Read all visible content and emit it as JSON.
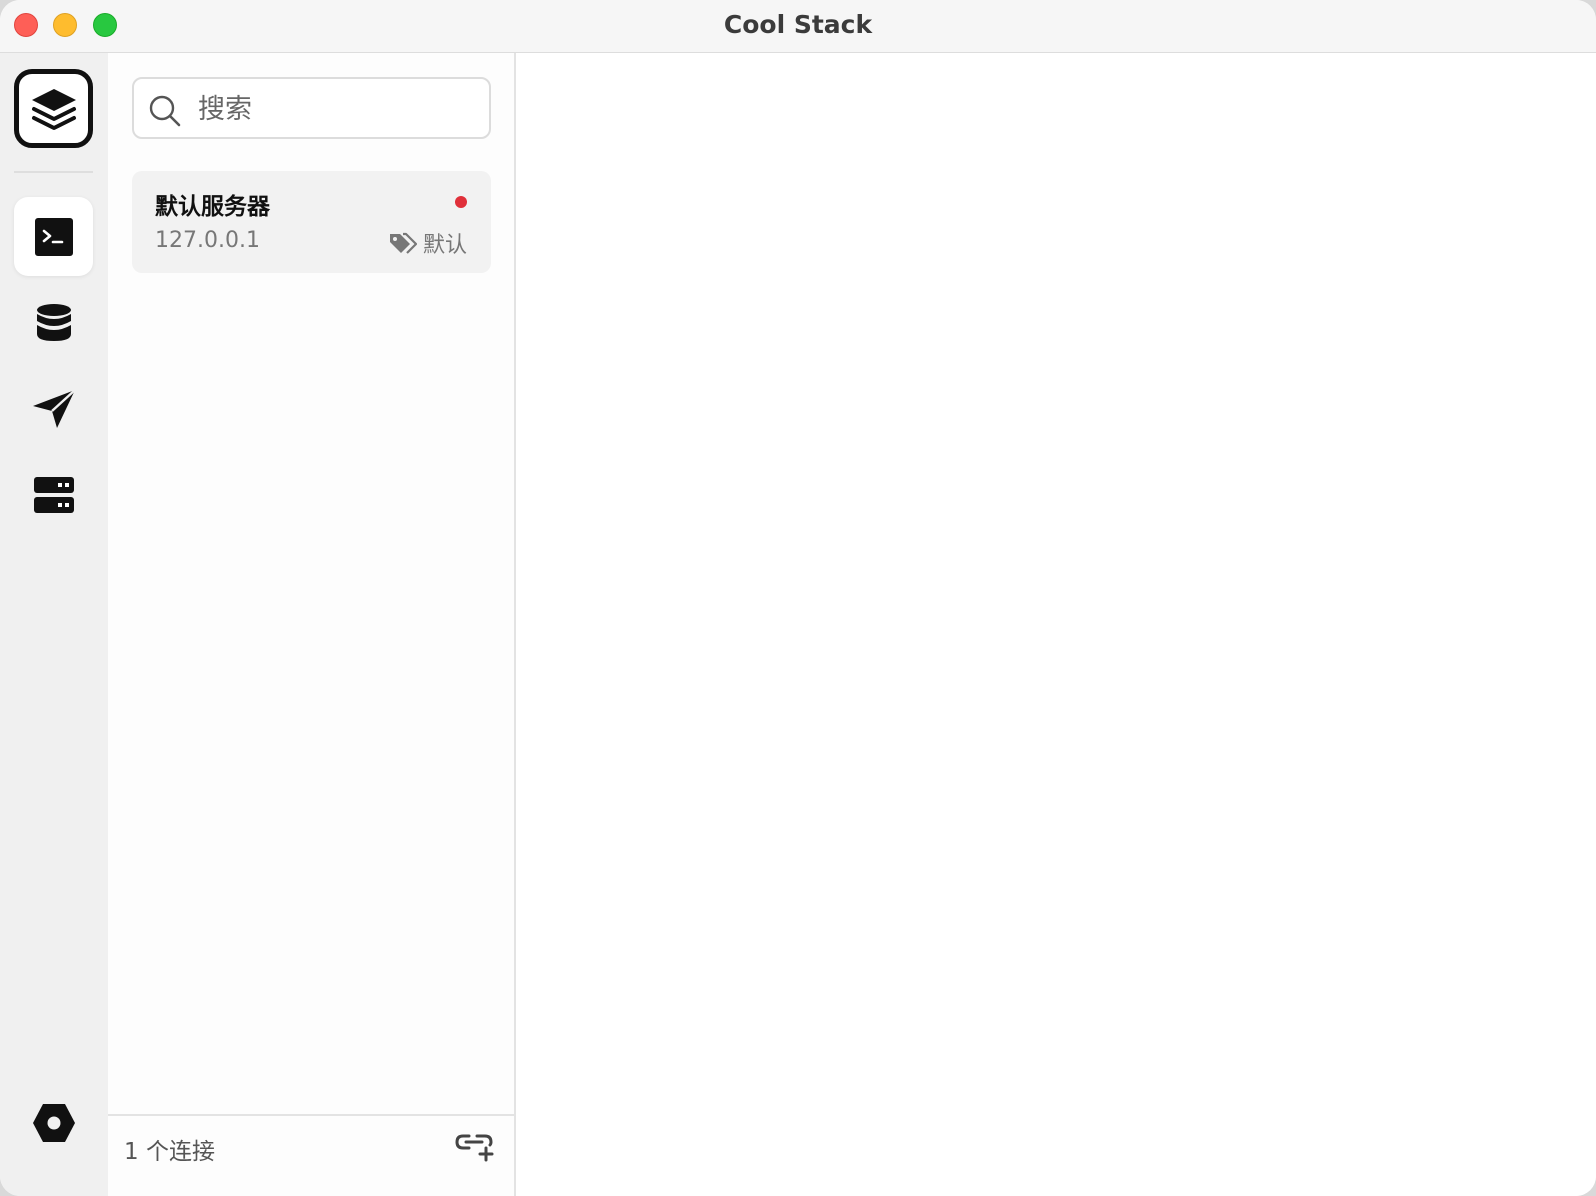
{
  "window": {
    "title": "Cool Stack"
  },
  "rail": {
    "logo_icon": "stack-layers-icon",
    "items": [
      {
        "id": "terminal",
        "icon": "terminal-icon",
        "active": true
      },
      {
        "id": "database",
        "icon": "database-icon",
        "active": false
      },
      {
        "id": "send",
        "icon": "paper-plane-icon",
        "active": false
      },
      {
        "id": "server",
        "icon": "server-icon",
        "active": false
      }
    ],
    "settings_icon": "settings-hexagon-icon"
  },
  "search": {
    "placeholder": "搜索",
    "value": ""
  },
  "connections": [
    {
      "name": "默认服务器",
      "host": "127.0.0.1",
      "tag": "默认",
      "status_color": "#e0303a"
    }
  ],
  "footer": {
    "count_label": "1 个连接",
    "add_icon": "add-link-icon"
  },
  "colors": {
    "accent_dark": "#111111",
    "status_offline": "#e0303a",
    "rail_bg": "#f0f0f0"
  }
}
